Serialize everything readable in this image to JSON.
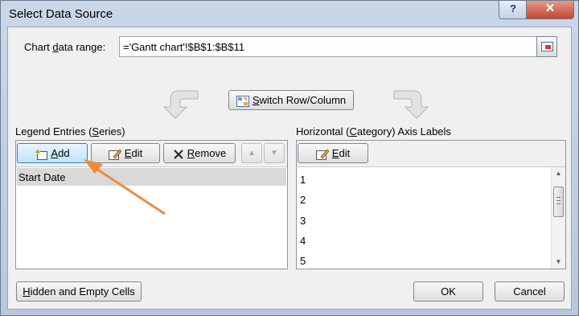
{
  "window": {
    "title": "Select Data Source",
    "help_label": "?",
    "close_label": "✕"
  },
  "range": {
    "label_pre": "Chart ",
    "label_u": "d",
    "label_post": "ata range:",
    "value": "='Gantt chart'!$B$1:$B$11",
    "button_icon": "collapse-dialog-icon"
  },
  "switch_button": {
    "pre": "",
    "u": "S",
    "post": "witch Row/Column",
    "icon": "switch-row-column-icon"
  },
  "legend": {
    "heading_pre": "Legend Entries (",
    "heading_u": "S",
    "heading_post": "eries)",
    "add": {
      "u": "A",
      "post": "dd",
      "icon": "add-series-icon"
    },
    "edit": {
      "u": "E",
      "post": "dit",
      "icon": "edit-icon"
    },
    "remove": {
      "u": "R",
      "post": "emove",
      "icon": "remove-x-icon"
    },
    "move_up": "▲",
    "move_down": "▼",
    "items": [
      "Start Date"
    ]
  },
  "axis": {
    "heading_pre": "Horizontal (",
    "heading_u": "C",
    "heading_post": "ategory) Axis Labels",
    "edit": {
      "u": "E",
      "post": "dit",
      "icon": "edit-icon"
    },
    "items": [
      "1",
      "2",
      "3",
      "4",
      "5"
    ]
  },
  "footer": {
    "hidden_u": "H",
    "hidden_post": "idden and Empty Cells",
    "ok": "OK",
    "cancel": "Cancel"
  },
  "colors": {
    "annotation_arrow": "#f08a3c",
    "selected_row": "#d9d9d9"
  }
}
